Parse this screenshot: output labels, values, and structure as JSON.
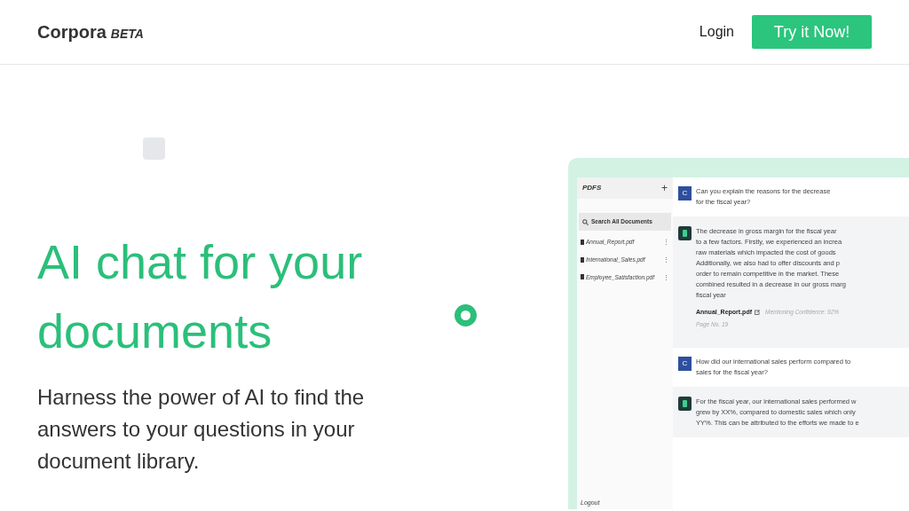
{
  "header": {
    "logo": "Corpora",
    "badge": "BETA",
    "login": "Login",
    "cta": "Try it Now!"
  },
  "hero": {
    "title": "AI chat for your documents",
    "subtitle": "Harness the power of AI to find the answers to your questions in your document library."
  },
  "mockup": {
    "sidebar": {
      "title": "PDFS",
      "add": "+",
      "search": "Search All Documents",
      "files": [
        {
          "name": "Annual_Report.pdf",
          "menu": "⋮"
        },
        {
          "name": "International_Sales.pdf",
          "menu": "⋮"
        },
        {
          "name": "Employee_Satisfaction.pdf",
          "menu": "⋮"
        }
      ],
      "logout": "Logout"
    },
    "messages": [
      {
        "kind": "question",
        "avatar": "C",
        "lines": [
          "Can you explain the reasons for the decrease",
          "for the fiscal year?"
        ]
      },
      {
        "kind": "answer",
        "lines": [
          "The decrease in gross margin for the fiscal year",
          "to a few factors. Firstly, we experienced an increa",
          "raw materials which impacted the cost of goods",
          "Additionally, we also had to offer discounts and p",
          "order to remain competitive in the market. These",
          "combined resulted in a decrease in our gross marg",
          "fiscal year"
        ],
        "source": {
          "file": "Annual_Report.pdf",
          "confidence": "Mentioning Confidence: 92%",
          "page": "Page No. 19"
        }
      },
      {
        "kind": "question",
        "avatar": "C",
        "lines": [
          "How did our international sales perform compared to",
          "sales for the fiscal year?"
        ]
      },
      {
        "kind": "answer",
        "lines": [
          "For the fiscal year, our international sales performed w",
          "grew by XX%, compared to domestic sales which only",
          "YY%. This can be attributed to the efforts we made to e"
        ]
      }
    ]
  }
}
